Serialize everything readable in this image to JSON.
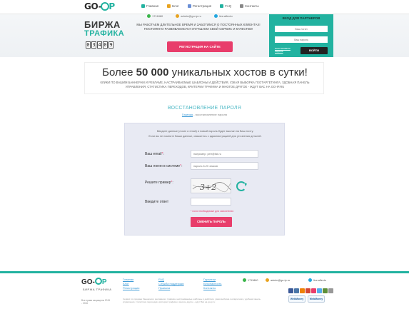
{
  "header": {
    "logo": {
      "left": "GO-",
      "right": "P"
    },
    "nav": [
      {
        "label": "Главная",
        "icon": "home-icon",
        "color": "#22b2a0"
      },
      {
        "label": "Блог",
        "icon": "pencil-icon",
        "color": "#e8a31f"
      },
      {
        "label": "Регистрация",
        "icon": "user-icon",
        "color": "#6a8fd6"
      },
      {
        "label": "FAQ",
        "icon": "question-icon",
        "color": "#22b2a0"
      },
      {
        "label": "Контакты",
        "icon": "mail-icon",
        "color": "#888888"
      }
    ],
    "contacts": [
      {
        "label": "1711860",
        "icon": "icq-icon"
      },
      {
        "label": "admin@go-ip.ru",
        "icon": "email-icon"
      },
      {
        "label": "live:alfecto",
        "icon": "skype-icon"
      }
    ]
  },
  "banner": {
    "brand_line1": "БИРЖА",
    "brand_line2": "ТРАФИКА",
    "counter_digits": [
      "0",
      "3",
      "4",
      "0",
      "9"
    ],
    "promo": "МЫ РАБОТАЕМ ДЛИТЕЛЬНОЕ ВРЕМЯ И ЗАБОТИМСЯ О ПОСТОЯННЫХ КЛИЕНТАХ! ПОСТОЯННО РАЗВИВАЕМСЯ И УЛУЧШАЕМ СВОЙ СЕРВИС И КАЧЕСТВО!",
    "register_button": "РЕГИСТРАЦИЯ НА САЙТЕ"
  },
  "partner_login": {
    "title": "ВХОД ДЛЯ ПАРТНЕРОВ",
    "login_placeholder": "Ваш логин",
    "password_placeholder": "Ваш пароль",
    "forgot_link": "восстановить пароль",
    "login_button": "ВОЙТИ"
  },
  "headline": {
    "pre": "Более ",
    "strong": "50 000",
    "post": " уникальных хостов в сутки!",
    "sub": "КЛИКИ ПО ВАШИМ БАННЕРАМ И РЕКЛАМЕ, НАСТРАИВАЕМЫЕ ШАБЛОНЫ И ДЕЙСТВИЯ, УЗКАЯ ВЫБОРКА ГЕОТАРГЕТИНГА, УДОБНАЯ ПАНЕЛЬ УПРАВЛЕНИЯ, СТАТИСТИКА ПЕРЕХОДОВ, КРИТЕРИИ ТРАФИКА И МНОГОЕ ДРУГОЕ - ЖДУТ ВАС НА GO-IP.RU"
  },
  "restore": {
    "title": "ВОССТАНОВЛЕНИЕ ПАРОЛЯ",
    "crumb_home": "Главная",
    "crumb_current": " - восстановление пароля",
    "note1": "Введите данные (логин и email) и новый пароль будет выслан на Ваш почту.",
    "note2": "Если вы не помните Ваши данные, свяжитесь с администрацией для уточнения деталей.",
    "email_label": "Ваш email",
    "email_placeholder": "например: petr@list.ru",
    "login_label": "Ваш логин в системе",
    "login_placeholder": "пароль 6-20 знаков",
    "captcha_label": "Решите пример",
    "answer_label": "Введите ответ",
    "required_note": "* поля необходимые для заполнения",
    "submit_button": "СМЕНИТЬ ПАРОЛЬ"
  },
  "footer": {
    "tagline": "БИРЖА ТРАФИКА",
    "copyright": "Все права защищены 2015 - 2016",
    "col1": [
      "Главная",
      "Блог",
      "Регистрация"
    ],
    "col2": [
      "FAQ",
      "Служба поддержки",
      "Правила"
    ],
    "col3": [
      "Гарантии",
      "Безопасность",
      "Контакты"
    ],
    "contacts": [
      "1711860",
      "admin@go-ip.ru",
      "live:alfecto"
    ],
    "description": "Сервис по продаже баннерного рекламного трафика, настраиваемые шаблоны и действия, узкая выборка геотаргетинга, удобная панель управления, статистика переходов, критерии трафика и многое другое - ждут Вас на go-ip.ru",
    "payments": [
      "WebMoney",
      "WebMoney"
    ],
    "social_colors": [
      "#3b5998",
      "#4a76a8",
      "#ee8208",
      "#d34836",
      "#e83d6b",
      "#55acee",
      "#5e8f3a",
      "#999999"
    ]
  }
}
